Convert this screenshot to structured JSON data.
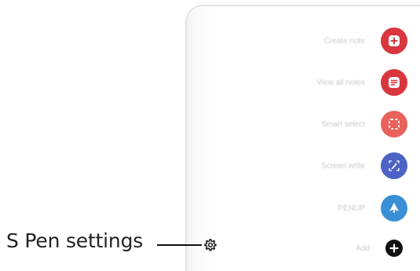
{
  "panel": {
    "items": [
      {
        "label": "Create note",
        "icon": "create-note-icon",
        "color": "#d9363e"
      },
      {
        "label": "View all notes",
        "icon": "view-notes-icon",
        "color": "#d9363e"
      },
      {
        "label": "Smart select",
        "icon": "smart-select-icon",
        "color": "#e8615b"
      },
      {
        "label": "Screen write",
        "icon": "screen-write-icon",
        "color": "#4c62c4"
      },
      {
        "label": "PENUP",
        "icon": "penup-icon",
        "color": "#3a8fd6"
      },
      {
        "label": "Add",
        "icon": "add-icon",
        "color": "#111111"
      }
    ]
  },
  "callout": {
    "text": "S Pen settings",
    "icon": "gear-icon"
  }
}
